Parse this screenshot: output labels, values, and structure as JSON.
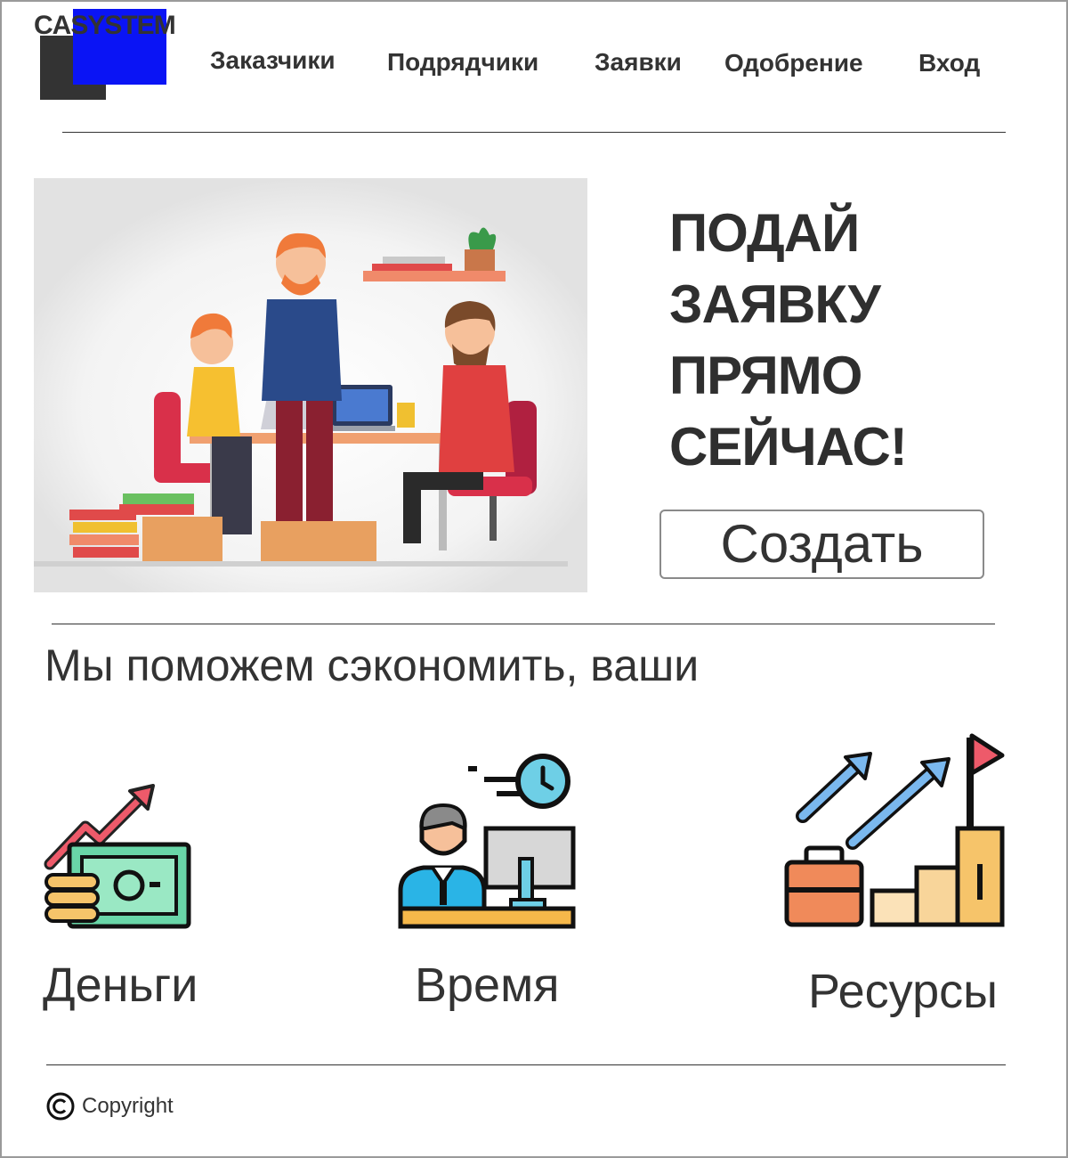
{
  "logo": {
    "text": "CASYSTEM"
  },
  "nav": {
    "items": [
      {
        "label": "Заказчики"
      },
      {
        "label": "Подрядчики"
      },
      {
        "label": "Заявки"
      },
      {
        "label": "Одобрение"
      },
      {
        "label": "Вход"
      }
    ]
  },
  "hero": {
    "title_lines": [
      "ПОДАЙ",
      "ЗАЯВКУ",
      "ПРЯМО",
      "СЕЙЧАС!"
    ],
    "create_button": "Создать"
  },
  "benefits": {
    "heading": "Мы поможем сэкономить, ваши",
    "items": [
      {
        "label": "Деньги",
        "icon": "money-growth-icon"
      },
      {
        "label": "Время",
        "icon": "time-worker-icon"
      },
      {
        "label": "Ресурсы",
        "icon": "resources-growth-icon"
      }
    ]
  },
  "footer": {
    "copyright": "Copyright",
    "icon": "copyright-icon"
  },
  "colors": {
    "logo_blue": "#0a14f5",
    "logo_dark": "#333333",
    "text": "#333333"
  }
}
